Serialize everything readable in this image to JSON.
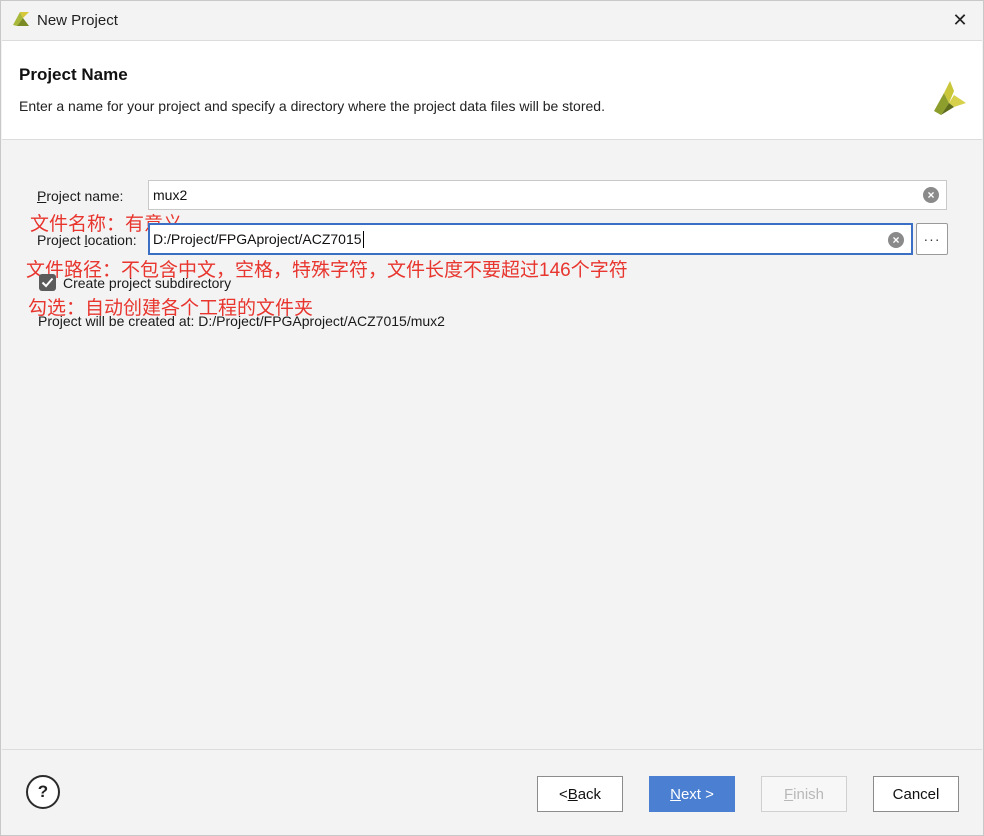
{
  "window": {
    "title": "New Project",
    "close_glyph": "✕"
  },
  "header": {
    "title": "Project Name",
    "description": "Enter a name for your project and specify a directory where the project data files will be stored.",
    "logo_icon": "vivado-logo-icon"
  },
  "form": {
    "project_name": {
      "label_prefix": "",
      "label_ul": "P",
      "label_rest": "roject name:",
      "value": "mux2"
    },
    "project_location": {
      "label_pre": "Project ",
      "label_ul": "l",
      "label_rest": "ocation:",
      "value": "D:/Project/FPGAproject/ACZ7015",
      "browse_label": "···"
    },
    "subdirectory": {
      "label": "Create project subdirectory",
      "checked": true
    },
    "created_at": "Project will be created at: D:/Project/FPGAproject/ACZ7015/mux2"
  },
  "annotations": {
    "name_note": "文件名称：有意义",
    "location_note": "文件路径：不包含中文，空格，特殊字符，文件长度不要超过146个字符",
    "checkbox_note": "勾选：自动创建各个工程的文件夹",
    "color": "#e8352e"
  },
  "footer": {
    "help_label": "?",
    "back": {
      "pre": "< ",
      "ul": "B",
      "rest": "ack"
    },
    "next": {
      "ul": "N",
      "rest": "ext >"
    },
    "finish": {
      "ul": "F",
      "rest": "inish"
    },
    "cancel": "Cancel"
  },
  "colors": {
    "accent": "#4a7fd1",
    "focus_border": "#3a6fc4",
    "logo_green": "#9aa832"
  }
}
